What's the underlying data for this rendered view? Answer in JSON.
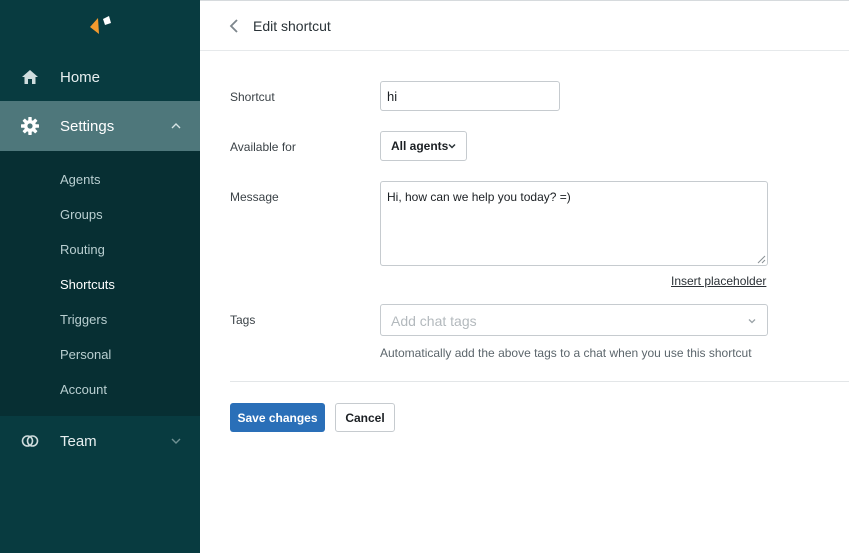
{
  "sidebar": {
    "home_label": "Home",
    "settings_label": "Settings",
    "team_label": "Team",
    "submenu": [
      {
        "label": "Agents"
      },
      {
        "label": "Groups"
      },
      {
        "label": "Routing"
      },
      {
        "label": "Shortcuts",
        "active": true
      },
      {
        "label": "Triggers"
      },
      {
        "label": "Personal"
      },
      {
        "label": "Account"
      }
    ]
  },
  "header": {
    "title": "Edit shortcut"
  },
  "form": {
    "shortcut_label": "Shortcut",
    "shortcut_value": "hi",
    "available_label": "Available for",
    "available_value": "All agents",
    "message_label": "Message",
    "message_value": "Hi, how can we help you today? =)",
    "insert_placeholder": "Insert placeholder",
    "tags_label": "Tags",
    "tags_placeholder": "Add chat tags",
    "tags_helper": "Automatically add the above tags to a chat when you use this shortcut"
  },
  "actions": {
    "save_label": "Save changes",
    "cancel_label": "Cancel"
  },
  "colors": {
    "sidebar_bg": "#083b40",
    "settings_active_bg": "#4e777b",
    "primary_button": "#2a6fb8",
    "logo_orange": "#f29a2e"
  },
  "icons": {
    "home": "home-icon",
    "settings": "gear-icon",
    "team": "team-icon",
    "back": "chevron-left-icon",
    "expand": "chevron-up-icon",
    "collapse": "chevron-down-icon"
  }
}
